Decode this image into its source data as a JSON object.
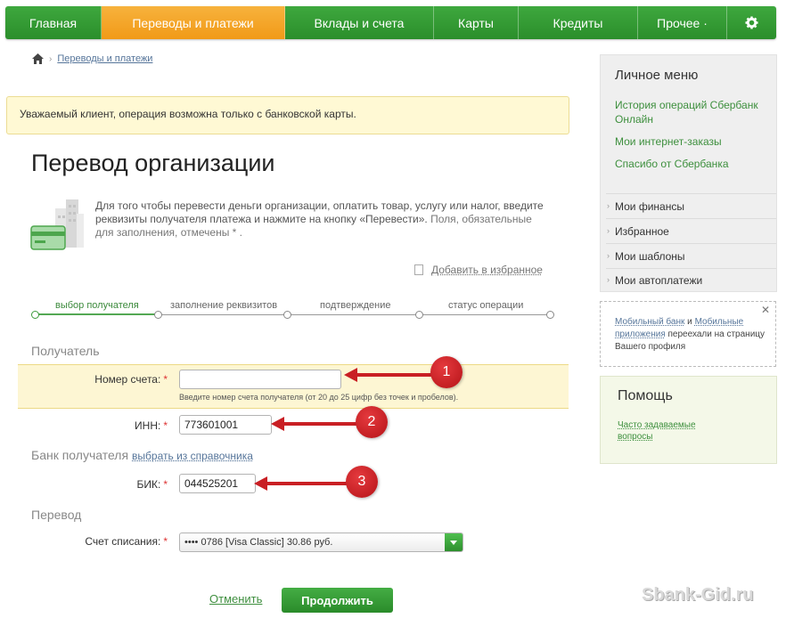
{
  "nav": {
    "items": [
      {
        "label": "Главная",
        "width": 108
      },
      {
        "label": "Переводы и платежи",
        "width": 206,
        "active": true
      },
      {
        "label": "Вклады и счета",
        "width": 167
      },
      {
        "label": "Карты",
        "width": 95
      },
      {
        "label": "Кредиты",
        "width": 134
      },
      {
        "label": "Прочее ·",
        "width": 100
      }
    ],
    "settings_icon": "gear-icon"
  },
  "breadcrumb": {
    "home_icon": "home-icon",
    "current": "Переводы и платежи"
  },
  "warning": "Уважаемый клиент, операция возможна только с банковской карты.",
  "page": {
    "title": "Перевод организации",
    "intro": "Для того чтобы перевести деньги организации, оплатить товар, услугу или налог, введите реквизиты получателя платежа и нажмите на кнопку «Перевести».",
    "required_note": "Поля, обязательные для заполнения, отмечены * ."
  },
  "favorites_label": "Добавить в избранное",
  "steps": [
    "выбор получателя",
    "заполнение реквизитов",
    "подтверждение",
    "статус операции"
  ],
  "sections": {
    "recipient": "Получатель",
    "bank": "Банк получателя",
    "bank_link": "выбрать из справочника",
    "transfer": "Перевод"
  },
  "fields": {
    "account": {
      "label": "Номер счета:",
      "value": "",
      "hint": "Введите номер счета получателя (от 20 до 25 цифр без точек и пробелов)."
    },
    "inn": {
      "label": "ИНН:",
      "value": "773601001"
    },
    "bik": {
      "label": "БИК:",
      "value": "044525201"
    },
    "debit": {
      "label": "Счет списания:",
      "value": "•••• 0786 [Visa Classic] 30.86 руб."
    }
  },
  "markers": [
    "1",
    "2",
    "3"
  ],
  "actions": {
    "cancel": "Отменить",
    "continue": "Продолжить"
  },
  "sidebar": {
    "title": "Личное меню",
    "links": [
      "История операций Сбербанк Онлайн",
      "Мои интернет-заказы",
      "Спасибо от Сбербанка"
    ],
    "items": [
      "Мои финансы",
      "Избранное",
      "Мои шаблоны",
      "Мои автоплатежи"
    ]
  },
  "notice": {
    "link1": "Мобильный банк",
    "and": " и ",
    "link2": "Мобильные приложения",
    "text": " переехали на страницу Вашего профиля"
  },
  "help": {
    "title": "Помощь",
    "link": "Часто задаваемые вопросы"
  },
  "watermark": "Sbank-Gid.ru",
  "colors": {
    "brand_green": "#2e962e",
    "accent_orange": "#f5a623",
    "marker_red": "#c91f24"
  }
}
